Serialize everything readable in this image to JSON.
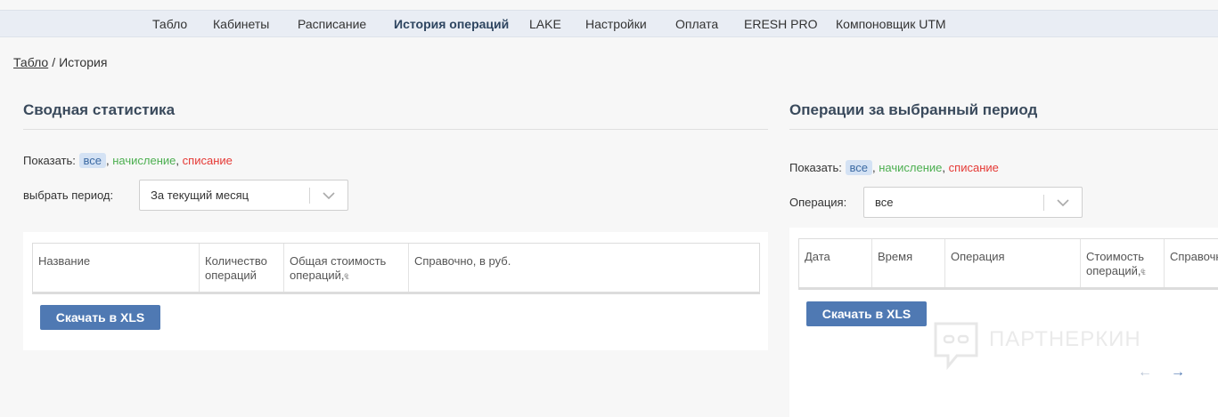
{
  "nav": {
    "items": [
      {
        "label": "Табло",
        "active": false
      },
      {
        "label": "Кабинеты",
        "active": false
      },
      {
        "label": "Расписание",
        "active": false
      },
      {
        "label": "История операций",
        "active": true
      },
      {
        "label": "LAKE",
        "active": false
      },
      {
        "label": "Настройки",
        "active": false
      },
      {
        "label": "Оплата",
        "active": false
      },
      {
        "label": "ERESH PRO",
        "active": false
      },
      {
        "label": "Компоновщик UTM",
        "active": false
      }
    ]
  },
  "breadcrumb": {
    "root": "Табло",
    "separator": "/",
    "current": "История"
  },
  "summary": {
    "title": "Сводная статистика",
    "filter": {
      "label": "Показать:",
      "all": "все",
      "credit": "начисление",
      "debit": "списание",
      "comma": ","
    },
    "period_label": "выбрать период:",
    "period_value": "За текущий месяц",
    "columns": [
      "Название",
      "Количество операций",
      "Общая стоимость операций,",
      "Справочно, в руб."
    ],
    "currency_glyph": "₠",
    "download_label": "Скачать в XLS"
  },
  "operations": {
    "title": "Операции за выбранный период",
    "filter": {
      "label": "Показать:",
      "all": "все",
      "credit": "начисление",
      "debit": "списание",
      "comma": ","
    },
    "operation_label": "Операция:",
    "operation_value": "все",
    "columns": [
      "Дата",
      "Время",
      "Операция",
      "Стоимость операций,",
      "Справочно"
    ],
    "currency_glyph": "₠",
    "download_label": "Скачать в XLS",
    "prev_arrow": "←",
    "next_arrow": "→"
  },
  "watermark": {
    "text": "ПАРТНЕРКИН"
  },
  "colors": {
    "accent": "#4f79b3",
    "credit": "#4caf50",
    "debit": "#e53935",
    "pill_bg": "#d4e2f4"
  }
}
